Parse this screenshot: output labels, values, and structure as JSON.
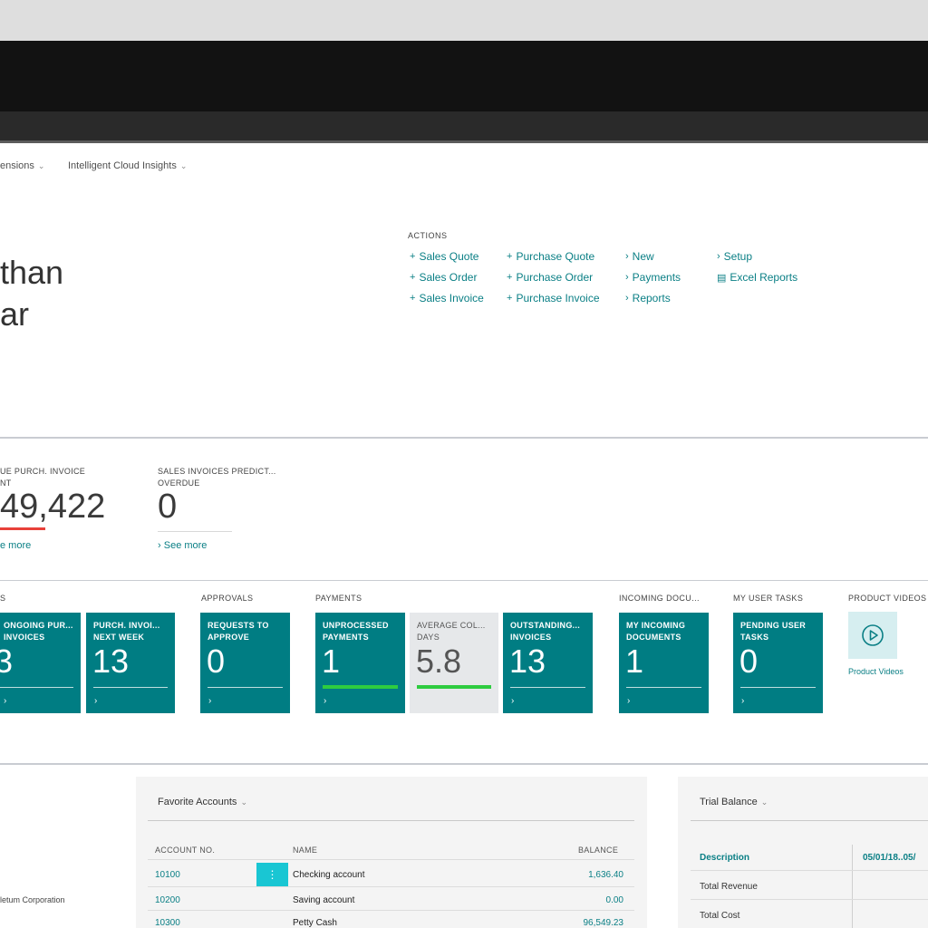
{
  "nav": [
    {
      "label": "ensions"
    },
    {
      "label": "Intelligent Cloud Insights"
    }
  ],
  "user": {
    "line1": "than",
    "line2": "ar"
  },
  "actions": {
    "title": "ACTIONS",
    "items": [
      {
        "icon": "plus-icon",
        "label": "Sales Quote"
      },
      {
        "icon": "plus-icon",
        "label": "Sales Order"
      },
      {
        "icon": "plus-icon",
        "label": "Sales Invoice"
      },
      {
        "icon": "plus-icon",
        "label": "Purchase Quote"
      },
      {
        "icon": "plus-icon",
        "label": "Purchase Order"
      },
      {
        "icon": "plus-icon",
        "label": "Purchase Invoice"
      },
      {
        "icon": "chevron-right-icon",
        "label": "New"
      },
      {
        "icon": "chevron-right-icon",
        "label": "Payments"
      },
      {
        "icon": "chevron-right-icon",
        "label": "Reports"
      },
      {
        "icon": "chevron-right-icon",
        "label": "Setup"
      },
      {
        "icon": "excel-icon",
        "label": "Excel Reports"
      }
    ]
  },
  "kpis": [
    {
      "title": "UE PURCH. INVOICE",
      "subtitle": "NT",
      "value": "49,422",
      "link": "e more",
      "indicator_color": "#e8403a"
    },
    {
      "title": "SALES INVOICES PREDICT...",
      "subtitle": "OVERDUE",
      "value": "0",
      "link": "See more",
      "indicator_color": "#d8d8d8"
    }
  ],
  "groups": [
    {
      "label": "S"
    },
    {
      "label": "APPROVALS"
    },
    {
      "label": "PAYMENTS"
    },
    {
      "label": "INCOMING DOCU..."
    },
    {
      "label": "MY USER TASKS"
    },
    {
      "label": "PRODUCT VIDEOS"
    }
  ],
  "tiles": [
    {
      "title": "ONGOING PUR... INVOICES",
      "value": "3"
    },
    {
      "title": "PURCH. INVOI... NEXT WEEK",
      "value": "13"
    },
    {
      "title": "REQUESTS TO APPROVE",
      "value": "0"
    },
    {
      "title": "UNPROCESSED PAYMENTS",
      "value": "1",
      "progress_color": "#2ecc40"
    },
    {
      "title": "AVERAGE COL... DAYS",
      "value": "5.8",
      "progress_color": "#2ecc40"
    },
    {
      "title": "OUTSTANDING... INVOICES",
      "value": "13"
    },
    {
      "title": "MY INCOMING DOCUMENTS",
      "value": "1"
    },
    {
      "title": "PENDING USER TASKS",
      "value": "0"
    }
  ],
  "product_videos": {
    "link": "Product Videos"
  },
  "left_company": "letum Corporation",
  "favorite_accounts": {
    "title": "Favorite Accounts",
    "columns": [
      "ACCOUNT NO.",
      "NAME",
      "BALANCE"
    ],
    "rows": [
      {
        "no": "10100",
        "name": "Checking account",
        "balance": "1,636.40"
      },
      {
        "no": "10200",
        "name": "Saving account",
        "balance": "0.00"
      },
      {
        "no": "10300",
        "name": "Petty Cash",
        "balance": "96,549.23"
      }
    ]
  },
  "trial_balance": {
    "title": "Trial Balance",
    "header_desc": "Description",
    "header_period": "05/01/18..05/",
    "rows": [
      "Total Revenue",
      "Total Cost"
    ]
  }
}
